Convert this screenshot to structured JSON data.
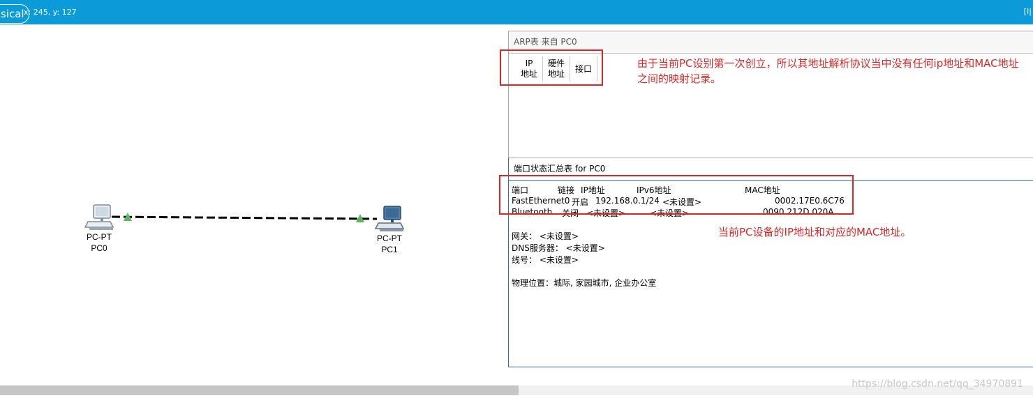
{
  "toolbar": {
    "mode_label": "sical",
    "coords": "x: 245, y: 127",
    "right_text": "[I|"
  },
  "devices": [
    {
      "model": "PC-PT",
      "name": "PC0"
    },
    {
      "model": "PC-PT",
      "name": "PC1"
    }
  ],
  "arp_window": {
    "title": "ARP表 来自 PC0",
    "columns": [
      [
        "IP",
        "地址"
      ],
      [
        "硬件",
        "地址"
      ],
      [
        "接口"
      ]
    ]
  },
  "port_window": {
    "title": "端口状态汇总表 for PC0",
    "header": {
      "port": "端口",
      "link": "链接",
      "ip": "IP地址",
      "ipv6": "IPv6地址",
      "mac": "MAC地址"
    },
    "rows": [
      {
        "port": "FastEthernet0",
        "link": "开启",
        "ip": "192.168.0.1/24",
        "ipv6": "<未设置>",
        "mac": "0002.17E0.6C76"
      },
      {
        "port": "Bluetooth",
        "link": "关闭",
        "ip": "<未设置>",
        "ipv6": "<未设置>",
        "mac": "0090.212D.020A"
      }
    ],
    "gateway": "网关： <未设置>",
    "dns": "DNS服务器： <未设置>",
    "line": "线号： <未设置>",
    "location": "物理位置：城际, 家园城市, 企业办公室"
  },
  "annotations": {
    "arp_note": "由于当前PC设别第一次创立，所以其地址解析协议当中没有任何ip地址和MAC地址之间的映射记录。",
    "port_note": "当前PC设备的IP地址和对应的MAC地址。",
    "color": "#e02424"
  },
  "watermark": "https://blog.csdn.net/qq_34970891",
  "colors": {
    "toolbar": "#0a9bd8",
    "link_up": "#5cb85c"
  }
}
